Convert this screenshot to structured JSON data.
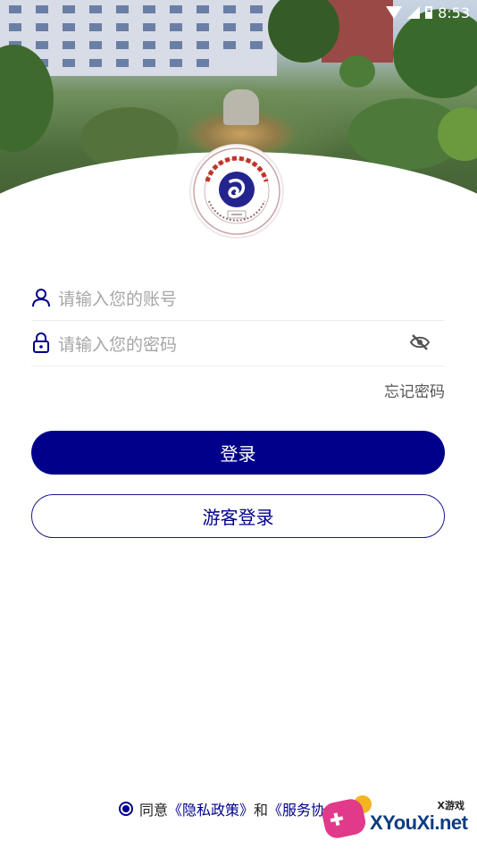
{
  "status_bar": {
    "time": "8:53"
  },
  "login": {
    "account_placeholder": "请输入您的账号",
    "password_placeholder": "请输入您的密码",
    "forgot_password": "忘记密码",
    "login_button": "登录",
    "guest_button": "游客登录"
  },
  "agreement": {
    "prefix": "同意",
    "privacy_policy": "《隐私政策》",
    "and": "和",
    "service_agreement": "《服务协"
  },
  "watermark": {
    "tag": "X游戏",
    "text": "XYouXi.net"
  },
  "colors": {
    "primary": "#00008b",
    "placeholder": "#a6a6a6"
  }
}
